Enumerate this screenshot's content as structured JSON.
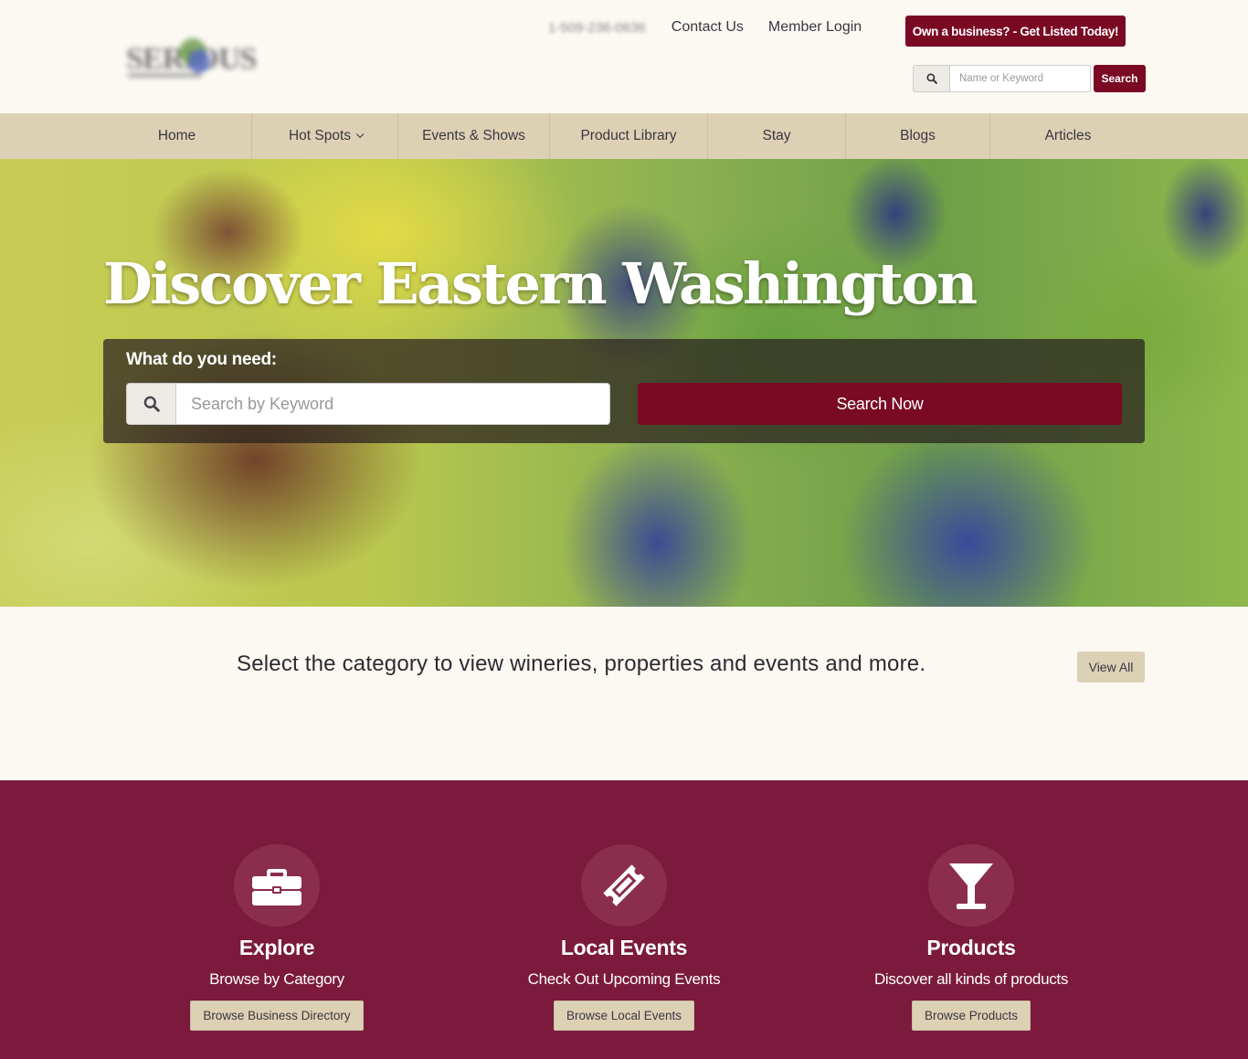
{
  "header": {
    "logo_text": "SERIOUS",
    "phone": "1-509-236-0636",
    "links": [
      "Contact Us",
      "Member Login"
    ],
    "cta_label": "Own a business? - Get Listed Today!",
    "search": {
      "placeholder": "Name or Keyword",
      "value": "",
      "button_label": "Search",
      "icon": "search-icon"
    }
  },
  "nav": {
    "items": [
      {
        "label": "Home",
        "dropdown": false
      },
      {
        "label": "Hot Spots",
        "dropdown": true
      },
      {
        "label": "Events & Shows",
        "dropdown": false
      },
      {
        "label": "Product Library",
        "dropdown": false
      },
      {
        "label": "Stay",
        "dropdown": false
      },
      {
        "label": "Blogs",
        "dropdown": false
      },
      {
        "label": "Articles",
        "dropdown": false
      }
    ]
  },
  "hero": {
    "title": "Discover Eastern Washington",
    "search_label": "What do you need:",
    "search_placeholder": "Search by Keyword",
    "search_value": "",
    "search_button": "Search Now",
    "search_icon": "search-icon"
  },
  "intro": {
    "text": "Select the category to view wineries, properties and events and more.",
    "view_all_label": "View All"
  },
  "features": [
    {
      "icon": "briefcase-icon",
      "title": "Explore",
      "subtitle": "Browse by Category",
      "button": "Browse Business Directory"
    },
    {
      "icon": "ticket-icon",
      "title": "Local Events",
      "subtitle": "Check Out Upcoming Events",
      "button": "Browse Local Events"
    },
    {
      "icon": "cocktail-glass-icon",
      "title": "Products",
      "subtitle": "Discover all kinds of products",
      "button": "Browse Products"
    }
  ],
  "colors": {
    "brand": "#7a0a24",
    "nav_bg": "#ddd1b5",
    "page_bg": "#fcf9f3",
    "features_bg": "#7b1a3c",
    "icon_circle": "#8b2e4e"
  }
}
